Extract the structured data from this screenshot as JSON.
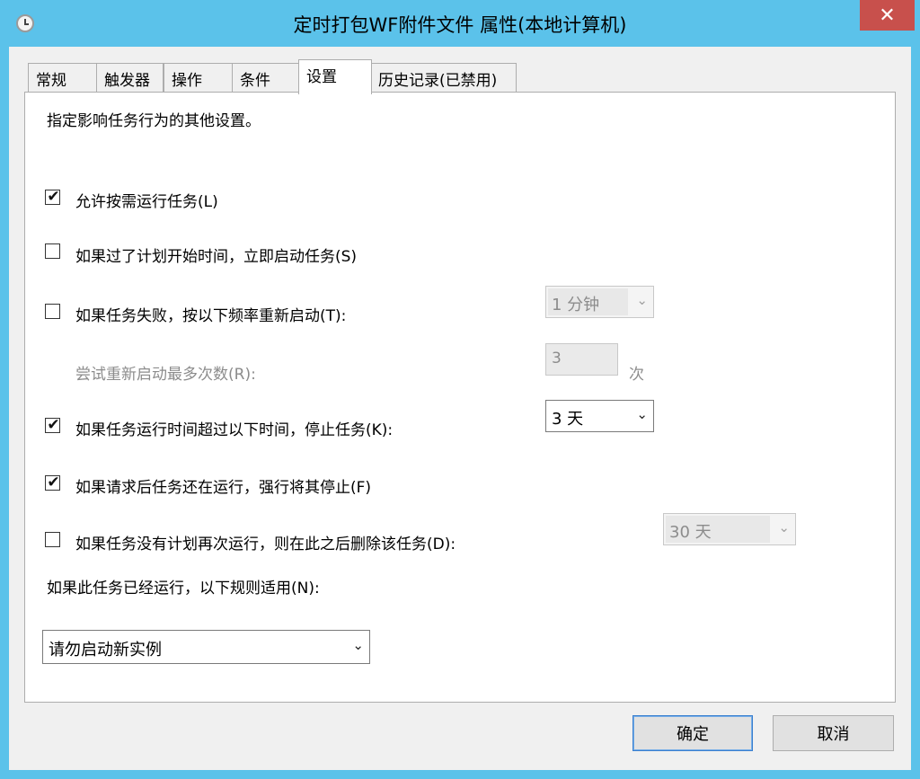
{
  "window": {
    "title": "定时打包WF附件文件 属性(本地计算机)",
    "close_glyph": "✕"
  },
  "tabs": [
    {
      "label": "常规",
      "active": false
    },
    {
      "label": "触发器",
      "active": false
    },
    {
      "label": "操作",
      "active": false
    },
    {
      "label": "条件",
      "active": false
    },
    {
      "label": "设置",
      "active": true
    },
    {
      "label": "历史记录(已禁用)",
      "active": false
    }
  ],
  "settings": {
    "description": "指定影响任务行为的其他设置。",
    "allow_on_demand": {
      "label": "允许按需运行任务(L)",
      "checked": true
    },
    "run_asap_missed": {
      "label": "如果过了计划开始时间，立即启动任务(S)",
      "checked": false
    },
    "restart_on_fail": {
      "label": "如果任务失败，按以下频率重新启动(T):",
      "checked": false,
      "interval": "1 分钟"
    },
    "restart_attempts": {
      "label": "尝试重新启动最多次数(R):",
      "value": "3",
      "unit": "次"
    },
    "stop_if_runs_longer": {
      "label": "如果任务运行时间超过以下时间，停止任务(K):",
      "checked": true,
      "duration": "3 天"
    },
    "force_stop": {
      "label": "如果请求后任务还在运行，强行将其停止(F)",
      "checked": true
    },
    "delete_if_not_scheduled": {
      "label": "如果任务没有计划再次运行，则在此之后删除该任务(D):",
      "checked": false,
      "delay": "30 天"
    },
    "if_running_rule": {
      "label": "如果此任务已经运行，以下规则适用(N):",
      "value": "请勿启动新实例"
    }
  },
  "footer": {
    "ok_label": "确定",
    "cancel_label": "取消"
  },
  "glyphs": {
    "check": "✔",
    "dropdown": "⌄"
  },
  "colors": {
    "frame": "#5bc2ea",
    "close": "#c8504c",
    "default_button_border": "#3a7fcf"
  }
}
